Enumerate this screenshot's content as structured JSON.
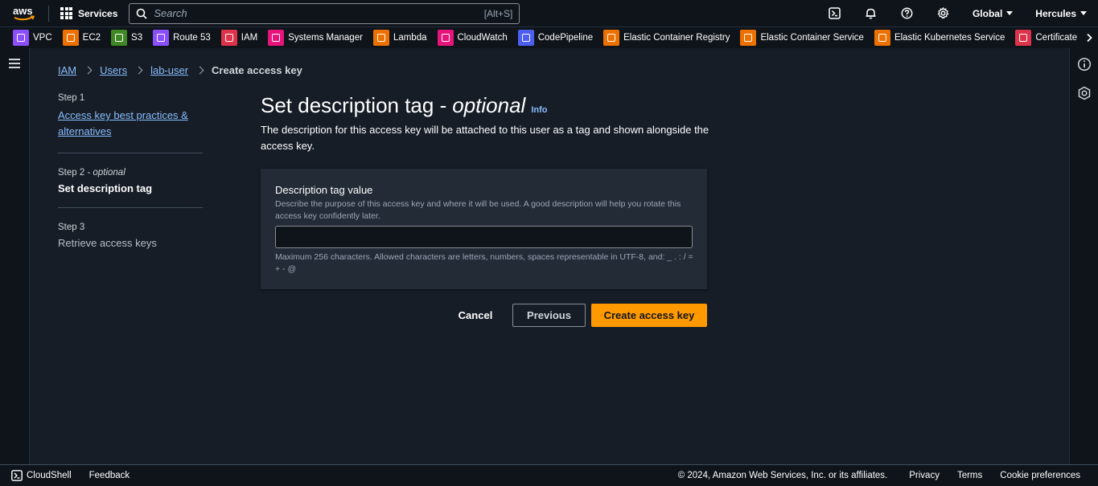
{
  "nav": {
    "logo_text": "aws",
    "services_label": "Services",
    "search_placeholder": "Search",
    "search_shortcut": "[Alt+S]",
    "region_label": "Global",
    "account_label": "Hercules"
  },
  "favorites": [
    {
      "label": "VPC",
      "color": "#8c4fff"
    },
    {
      "label": "EC2",
      "color": "#ed7100"
    },
    {
      "label": "S3",
      "color": "#3f8624"
    },
    {
      "label": "Route 53",
      "color": "#8c4fff"
    },
    {
      "label": "IAM",
      "color": "#dd344c"
    },
    {
      "label": "Systems Manager",
      "color": "#e7157b"
    },
    {
      "label": "Lambda",
      "color": "#ed7100"
    },
    {
      "label": "CloudWatch",
      "color": "#e7157b"
    },
    {
      "label": "CodePipeline",
      "color": "#4d5ff0"
    },
    {
      "label": "Elastic Container Registry",
      "color": "#ed7100"
    },
    {
      "label": "Elastic Container Service",
      "color": "#ed7100"
    },
    {
      "label": "Elastic Kubernetes Service",
      "color": "#ed7100"
    },
    {
      "label": "Certificate Man",
      "color": "#dd344c"
    }
  ],
  "breadcrumb": {
    "items": [
      "IAM",
      "Users",
      "lab-user"
    ],
    "current": "Create access key"
  },
  "steps": {
    "step1": {
      "label": "Step 1",
      "title": "Access key best practices & alternatives"
    },
    "step2": {
      "label": "Step 2 - ",
      "label_optional": "optional",
      "title": "Set description tag"
    },
    "step3": {
      "label": "Step 3",
      "title": "Retrieve access keys"
    }
  },
  "main": {
    "heading": "Set description tag -",
    "heading_optional": "optional",
    "info_label": "Info",
    "description": "The description for this access key will be attached to this user as a tag and shown alongside the access key.",
    "field": {
      "label": "Description tag value",
      "description": "Describe the purpose of this access key and where it will be used. A good description will help you rotate this access key confidently later.",
      "value": "",
      "constraint": "Maximum 256 characters. Allowed characters are letters, numbers, spaces representable in UTF-8, and: _ . : / = + - @"
    }
  },
  "actions": {
    "cancel": "Cancel",
    "previous": "Previous",
    "create": "Create access key"
  },
  "footer": {
    "cloudshell": "CloudShell",
    "feedback": "Feedback",
    "copyright": "© 2024, Amazon Web Services, Inc. or its affiliates.",
    "privacy": "Privacy",
    "terms": "Terms",
    "cookies": "Cookie preferences"
  },
  "colors": {
    "accent": "#ff9900",
    "link": "#89bdff"
  }
}
